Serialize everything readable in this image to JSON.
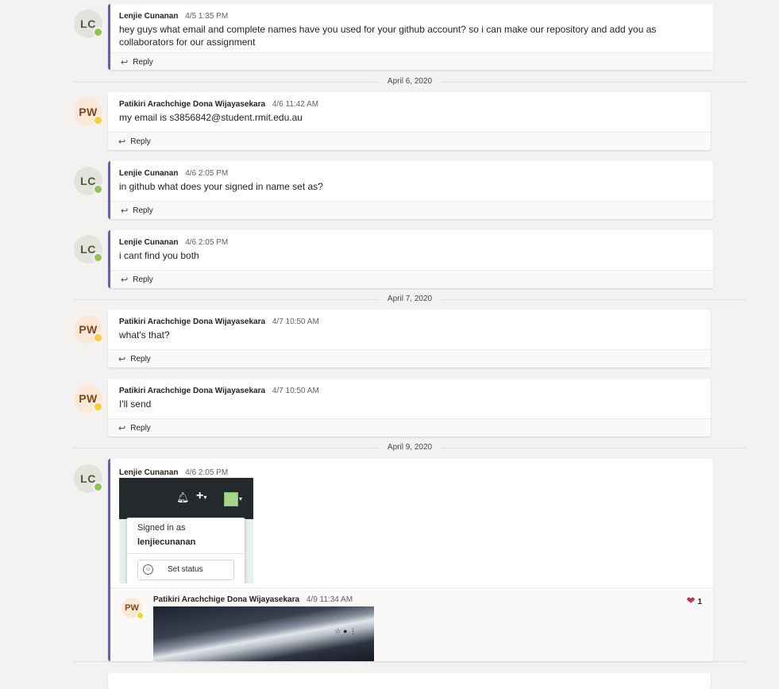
{
  "reply_label": "Reply",
  "messages": [
    {
      "initials": "LC",
      "author": "Lenjie Cunanan",
      "time": "4/5 1:35 PM",
      "text": "hey guys what email and complete names have you used for your github account? so i can make our repository and add you as collaborators for our assignment"
    },
    {
      "initials": "PW",
      "author": "Patikiri Arachchige Dona Wijayasekara",
      "time": "4/6 11:42 AM",
      "text": "my email is s3856842@student.rmit.edu.au"
    },
    {
      "initials": "LC",
      "author": "Lenjie Cunanan",
      "time": "4/6 2:05 PM",
      "text": "in github what does your signed in name set as?"
    },
    {
      "initials": "LC",
      "author": "Lenjie Cunanan",
      "time": "4/6 2:05 PM",
      "text": "i cant find you both"
    },
    {
      "initials": "PW",
      "author": "Patikiri Arachchige Dona Wijayasekara",
      "time": "4/7 10:50 AM",
      "text": "what's that?"
    },
    {
      "initials": "PW",
      "author": "Patikiri Arachchige Dona Wijayasekara",
      "time": "4/7 10:50 AM",
      "text": "I'll send"
    },
    {
      "initials": "LC",
      "author": "Lenjie Cunanan",
      "time": "4/6 2:05 PM",
      "text": ""
    }
  ],
  "dates": [
    "April 6, 2020",
    "April 7, 2020",
    "April 9, 2020"
  ],
  "screenshot": {
    "signed_in_as": "Signed in as",
    "username": "lenjiecunanan",
    "set_status": "Set status"
  },
  "thread_reply": {
    "initials": "PW",
    "author": "Patikiri Arachchige Dona Wijayasekara",
    "time": "4/9 11:34 AM",
    "reaction_count": "1"
  },
  "colors": {
    "accent": "#6264a7",
    "available": "#92c353",
    "away": "#f8d22a",
    "heart": "#c4314b"
  }
}
